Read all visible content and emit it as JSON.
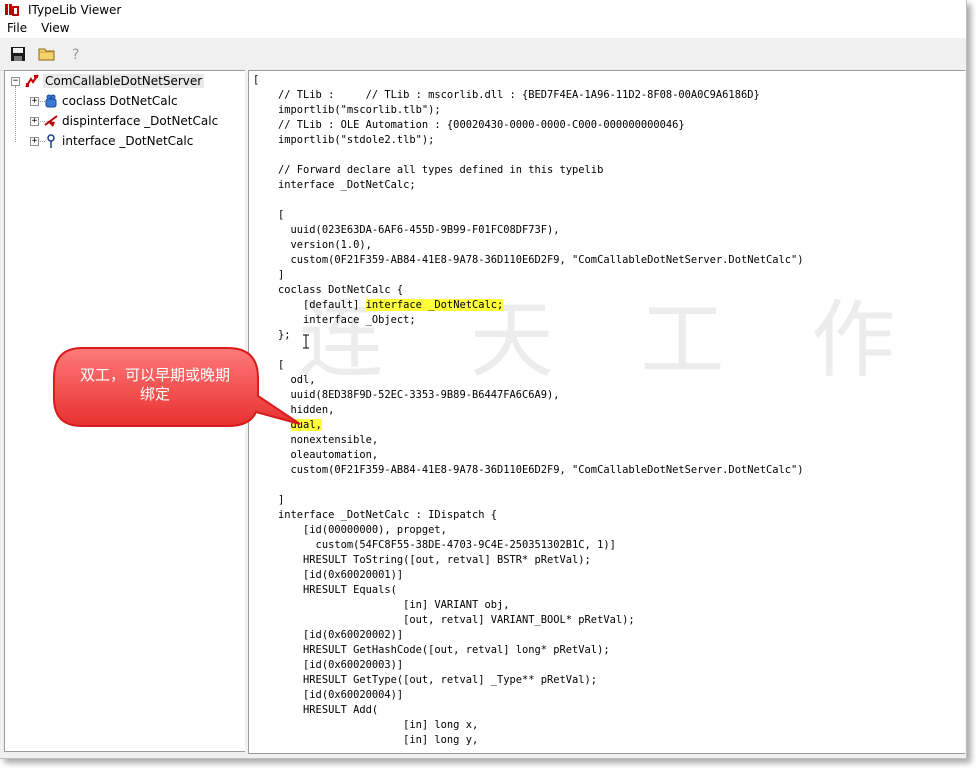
{
  "window": {
    "title": "ITypeLib Viewer"
  },
  "menu": {
    "file": "File",
    "view": "View"
  },
  "toolbar": {
    "save_icon": "floppy-disk-icon",
    "open_icon": "folder-icon",
    "help_icon": "help-question-icon"
  },
  "tree": {
    "root": {
      "label": "ComCallableDotNetServer",
      "icon": "typelib-icon",
      "expander": "−"
    },
    "items": [
      {
        "label": "coclass DotNetCalc",
        "icon": "coclass-icon",
        "expander": "+"
      },
      {
        "label": "dispinterface _DotNetCalc",
        "icon": "dispinterface-icon",
        "expander": "+"
      },
      {
        "label": "interface _DotNetCalc",
        "icon": "interface-icon",
        "expander": "+"
      }
    ]
  },
  "code": {
    "open_brace": "[",
    "l1": "    // TLib :     // TLib : mscorlib.dll : {BED7F4EA-1A96-11D2-8F08-00A0C9A6186D}",
    "l2": "    importlib(\"mscorlib.tlb\");",
    "l3": "    // TLib : OLE Automation : {00020430-0000-0000-C000-000000000046}",
    "l4": "    importlib(\"stdole2.tlb\");",
    "l5": "",
    "l6": "    // Forward declare all types defined in this typelib",
    "l7": "    interface _DotNetCalc;",
    "l8": "",
    "l9": "    [",
    "l10": "      uuid(023E63DA-6AF6-455D-9B99-F01FC08DF73F),",
    "l11": "      version(1.0),",
    "l12": "      custom(0F21F359-AB84-41E8-9A78-36D110E6D2F9, \"ComCallableDotNetServer.DotNetCalc\")",
    "l13": "    ]",
    "l14": "    coclass DotNetCalc {",
    "l15_pre": "        [default] ",
    "l15_hl": "interface _DotNetCalc;",
    "l16": "        interface _Object;",
    "l17": "    };",
    "l18": "",
    "l19": "    [",
    "l20": "      odl,",
    "l21": "      uuid(8ED38F9D-52EC-3353-9B89-B6447FA6C6A9),",
    "l22": "      hidden,",
    "l23_hl": "dual,",
    "l24": "      nonextensible,",
    "l25": "      oleautomation,",
    "l26": "      custom(0F21F359-AB84-41E8-9A78-36D110E6D2F9, \"ComCallableDotNetServer.DotNetCalc\")",
    "l27": "",
    "l28": "    ]",
    "l29": "    interface _DotNetCalc : IDispatch {",
    "l30": "        [id(00000000), propget,",
    "l31": "          custom(54FC8F55-38DE-4703-9C4E-250351302B1C, 1)]",
    "l32": "        HRESULT ToString([out, retval] BSTR* pRetVal);",
    "l33": "        [id(0x60020001)]",
    "l34": "        HRESULT Equals(",
    "l35": "                        [in] VARIANT obj,",
    "l36": "                        [out, retval] VARIANT_BOOL* pRetVal);",
    "l37": "        [id(0x60020002)]",
    "l38": "        HRESULT GetHashCode([out, retval] long* pRetVal);",
    "l39": "        [id(0x60020003)]",
    "l40": "        HRESULT GetType([out, retval] _Type** pRetVal);",
    "l41": "        [id(0x60020004)]",
    "l42": "        HRESULT Add(",
    "l43": "                        [in] long x,",
    "l44": "                        [in] long y,"
  },
  "callout": {
    "line1": "双工，可以早期或晚期",
    "line2": "绑定",
    "fill_color": "#f04a4a",
    "border_color": "#e02020"
  },
  "watermark": {
    "text": "连 天 工 作 室"
  },
  "colors": {
    "highlight": "#ffff3a"
  }
}
